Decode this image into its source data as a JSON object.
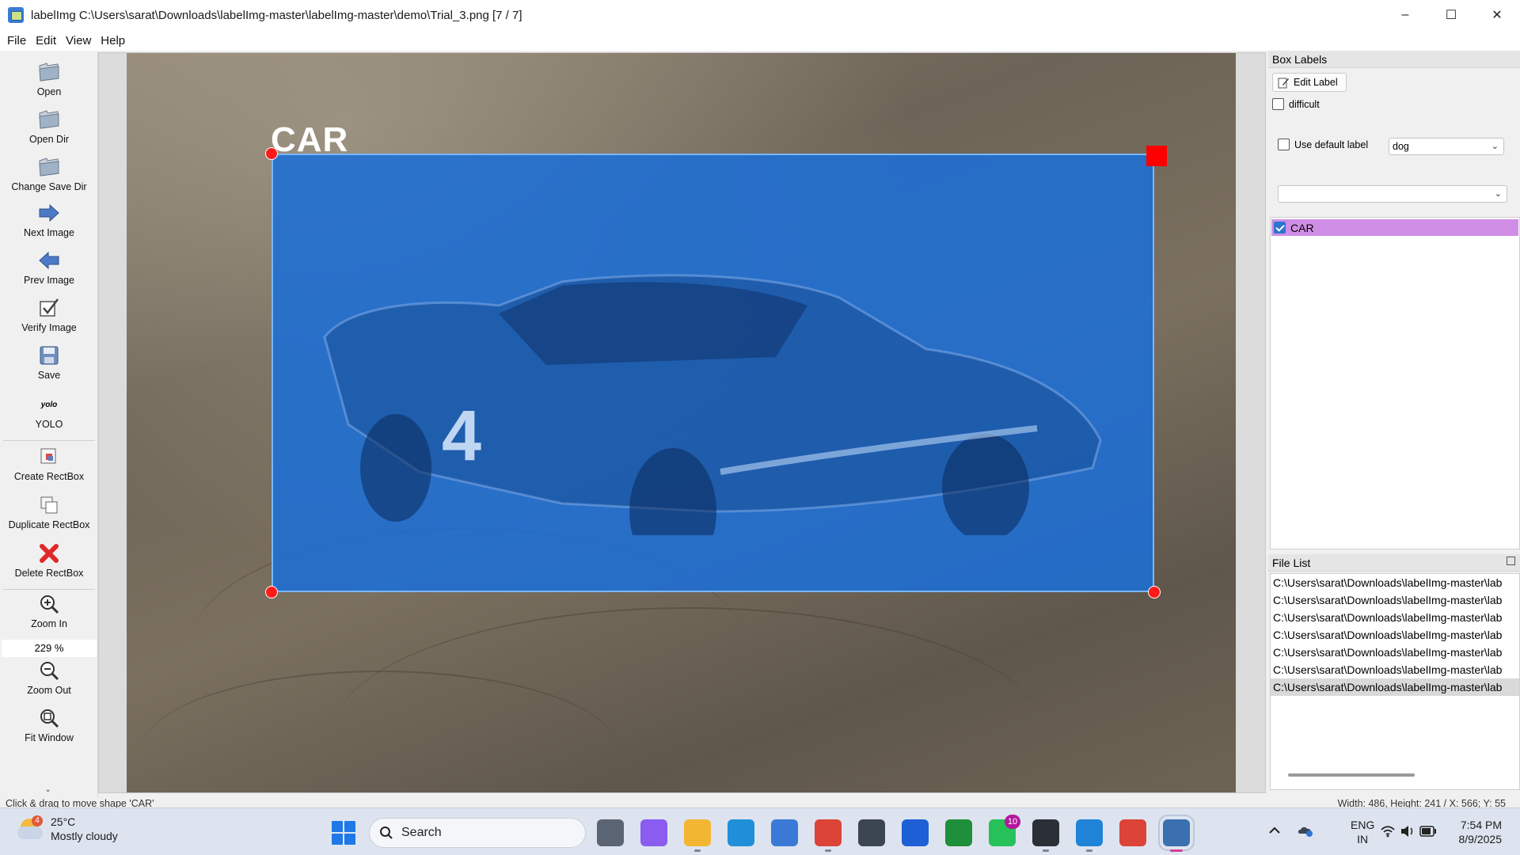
{
  "window": {
    "title": "labelImg C:\\Users\\sarat\\Downloads\\labelImg-master\\labelImg-master\\demo\\Trial_3.png [7 / 7]",
    "minimize": "–",
    "maximize": "☐",
    "close": "✕"
  },
  "menu": [
    "File",
    "Edit",
    "View",
    "Help"
  ],
  "toolbar": {
    "open": "Open",
    "open_dir": "Open Dir",
    "change_save_dir": "Change Save Dir",
    "next_image": "Next Image",
    "prev_image": "Prev Image",
    "verify_image": "Verify Image",
    "save": "Save",
    "format_icon_text": "yolo",
    "format": "YOLO",
    "create_rectbox": "Create RectBox",
    "duplicate_rectbox": "Duplicate RectBox",
    "delete_rectbox": "Delete RectBox",
    "zoom_in": "Zoom In",
    "zoom_value": "229 %",
    "zoom_out": "Zoom Out",
    "fit_window": "Fit Window",
    "extension_chevron": "⌄"
  },
  "canvas": {
    "shape_label": "CAR",
    "car_number": "4",
    "box_color": "#1c6ed6",
    "vertex_color": "#ff1a1a"
  },
  "box_labels_panel": {
    "title": "Box Labels",
    "edit_label": "Edit Label",
    "difficult": "difficult",
    "use_default_label": "Use default label",
    "default_label_value": "dog",
    "filter_value": "",
    "labels": [
      {
        "name": "CAR",
        "checked": true,
        "color": "#d08ee6"
      }
    ]
  },
  "file_list_panel": {
    "title": "File List",
    "files": [
      "C:\\Users\\sarat\\Downloads\\labelImg-master\\lab",
      "C:\\Users\\sarat\\Downloads\\labelImg-master\\lab",
      "C:\\Users\\sarat\\Downloads\\labelImg-master\\lab",
      "C:\\Users\\sarat\\Downloads\\labelImg-master\\lab",
      "C:\\Users\\sarat\\Downloads\\labelImg-master\\lab",
      "C:\\Users\\sarat\\Downloads\\labelImg-master\\lab",
      "C:\\Users\\sarat\\Downloads\\labelImg-master\\lab"
    ],
    "selected_index": 6
  },
  "status": {
    "message": "Click & drag to move shape 'CAR'",
    "coords": "Width: 486, Height: 241 / X: 566; Y: 55"
  },
  "taskbar": {
    "temperature": "25°C",
    "weather": "Mostly cloudy",
    "weather_badge": "4",
    "search": "Search",
    "whatsapp_badge": "10",
    "language_1": "ENG",
    "language_2": "IN",
    "time": "7:54 PM",
    "date": "8/9/2025",
    "apps": [
      {
        "name": "task-view-icon",
        "color": "#5b6472"
      },
      {
        "name": "copilot-icon",
        "color": "#8a5cf0"
      },
      {
        "name": "file-explorer-icon",
        "color": "#f2b632"
      },
      {
        "name": "edge-icon",
        "color": "#1f8fd9"
      },
      {
        "name": "microsoft-store-icon",
        "color": "#3a79d6"
      },
      {
        "name": "chrome-icon",
        "color": "#db4437"
      },
      {
        "name": "unity-icon",
        "color": "#3c4652"
      },
      {
        "name": "azure-icon",
        "color": "#1e5fd6"
      },
      {
        "name": "xbox-icon",
        "color": "#1e8f3a"
      },
      {
        "name": "whatsapp-icon",
        "color": "#27c15a"
      },
      {
        "name": "terminal-icon",
        "color": "#2b2f36"
      },
      {
        "name": "vscode-icon",
        "color": "#1f84d8"
      },
      {
        "name": "chrome-profile-icon",
        "color": "#db4437"
      },
      {
        "name": "python-icon",
        "color": "#3a6fb0"
      }
    ]
  }
}
